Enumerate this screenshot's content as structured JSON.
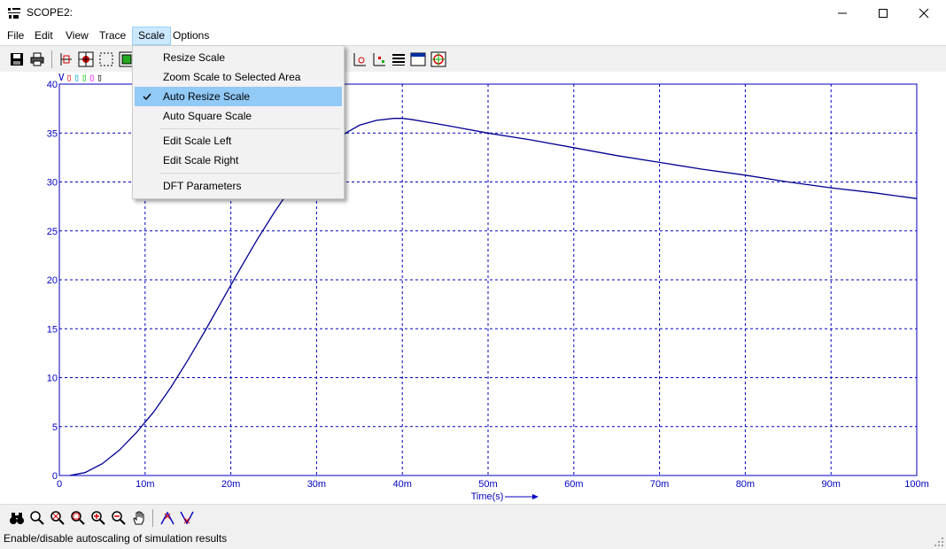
{
  "window": {
    "title": "SCOPE2:",
    "icon_name": "scope-app-icon",
    "controls": [
      "minimize-icon",
      "maximize-icon",
      "close-icon"
    ]
  },
  "menubar": {
    "items": [
      {
        "label": "File"
      },
      {
        "label": "Edit"
      },
      {
        "label": "View"
      },
      {
        "label": "Trace"
      },
      {
        "label": "Scale"
      },
      {
        "label": "Options"
      }
    ],
    "active": "Scale"
  },
  "scale_menu": {
    "items": [
      {
        "label": "Resize Scale",
        "checked": false,
        "highlighted": false
      },
      {
        "label": "Zoom Scale to Selected Area",
        "checked": false,
        "highlighted": false
      },
      {
        "label": "Auto Resize Scale",
        "checked": true,
        "highlighted": true
      },
      {
        "label": "Auto Square Scale",
        "checked": false,
        "highlighted": false
      },
      {
        "label": "Edit Scale Left",
        "checked": false,
        "highlighted": false
      },
      {
        "label": "Edit Scale Right",
        "checked": false,
        "highlighted": false
      },
      {
        "label": "DFT Parameters",
        "checked": false,
        "highlighted": false
      }
    ]
  },
  "toolbar": {
    "left_icons": [
      "save-icon",
      "print-icon",
      "cursor-mode-icon",
      "target-icon",
      "select-area-icon",
      "zoom-fit-icon"
    ],
    "right_icons": [
      "marker-icon",
      "axis-icon",
      "table-icon",
      "window-icon",
      "crosshair-icon"
    ]
  },
  "trace_legend": {
    "items": [
      {
        "label": "V",
        "color": "#0000c0"
      },
      {
        "label": "▯",
        "color": "#e00000"
      },
      {
        "label": "▯",
        "color": "#00a0e0"
      },
      {
        "label": "▯",
        "color": "#00c000"
      },
      {
        "label": "▯",
        "color": "#e000e0"
      },
      {
        "label": "▯",
        "color": "#000000"
      }
    ]
  },
  "chart_data": {
    "type": "line",
    "title": "",
    "xlabel": "Time(s)",
    "ylabel": "",
    "xlim": [
      0,
      0.1
    ],
    "ylim": [
      0,
      40
    ],
    "x_ticks": [
      0,
      0.01,
      0.02,
      0.03,
      0.04,
      0.05,
      0.06,
      0.07,
      0.08,
      0.09,
      0.1
    ],
    "x_tick_labels": [
      "0",
      "10m",
      "20m",
      "30m",
      "40m",
      "50m",
      "60m",
      "70m",
      "80m",
      "90m",
      "100m"
    ],
    "y_ticks": [
      0,
      5,
      10,
      15,
      20,
      25,
      30,
      35,
      40
    ],
    "y_tick_labels": [
      "0",
      "5",
      "10",
      "15",
      "20",
      "25",
      "30",
      "35",
      "40"
    ],
    "grid": true,
    "grid_style": "dashed",
    "line_color": "#000090",
    "axis_color": "#0000c0",
    "series": [
      {
        "x": [
          0.0012,
          0.003,
          0.005,
          0.007,
          0.009,
          0.011,
          0.013,
          0.015,
          0.017,
          0.019,
          0.021,
          0.023,
          0.025,
          0.027,
          0.029,
          0.031,
          0.033,
          0.035,
          0.037,
          0.039,
          0.04,
          0.041,
          0.043,
          0.045,
          0.05,
          0.055,
          0.06,
          0.065,
          0.07,
          0.075,
          0.08,
          0.085,
          0.09,
          0.095,
          0.1
        ],
        "y": [
          0,
          0.3,
          1.2,
          2.6,
          4.4,
          6.5,
          9.0,
          11.8,
          14.8,
          17.9,
          21.0,
          24.0,
          26.8,
          29.4,
          31.6,
          33.4,
          34.8,
          35.8,
          36.3,
          36.5,
          36.5,
          36.4,
          36.1,
          35.8,
          35.0,
          34.3,
          33.5,
          32.7,
          32.0,
          31.3,
          30.7,
          30.0,
          29.4,
          28.9,
          28.3
        ]
      }
    ]
  },
  "bottom_toolbar": {
    "icons": [
      "binoculars-icon",
      "zoom-icon",
      "zoom-out-full-icon",
      "zoom-area-icon",
      "zoom-in-icon",
      "zoom-out-icon",
      "pan-hand-icon",
      "peak-icon",
      "valley-icon"
    ]
  },
  "status": {
    "text": "Enable/disable autoscaling of simulation results"
  }
}
